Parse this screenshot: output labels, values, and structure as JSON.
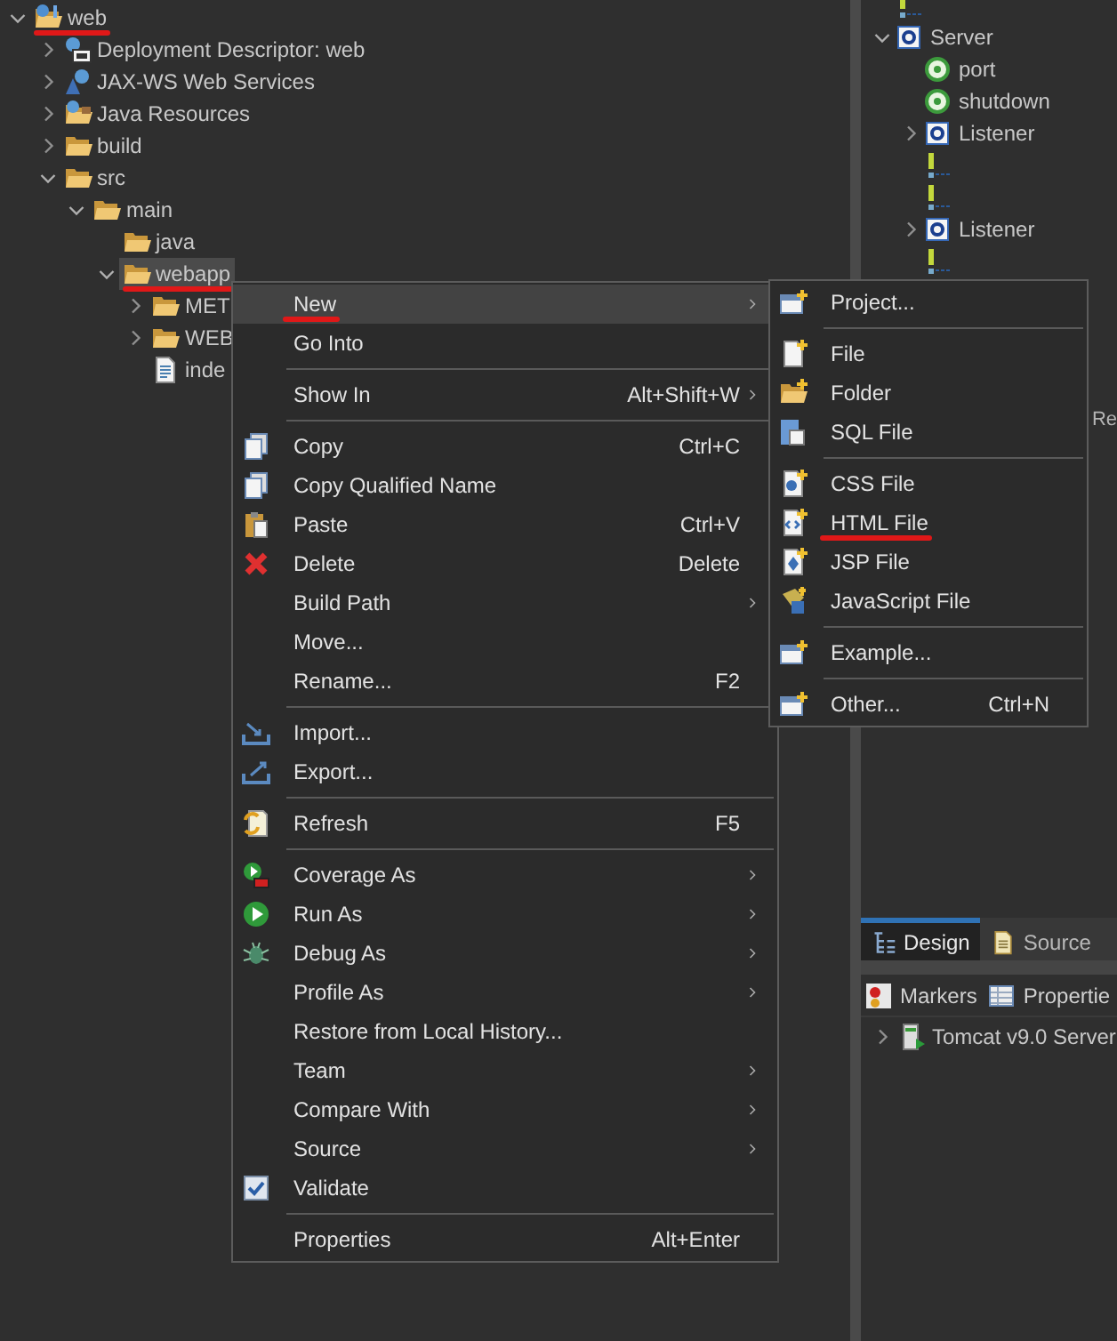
{
  "tree": [
    {
      "label": "web",
      "kind": "project",
      "expanded": true,
      "selected": false,
      "underlined": true,
      "children": [
        {
          "label": "Deployment Descriptor: web",
          "kind": "descriptor",
          "expanded": false,
          "selected": false,
          "underlined": false
        },
        {
          "label": "JAX-WS Web Services",
          "kind": "services",
          "expanded": false,
          "selected": false,
          "underlined": false
        },
        {
          "label": "Java Resources",
          "kind": "resources",
          "expanded": false,
          "selected": false,
          "underlined": false
        },
        {
          "label": "build",
          "kind": "folder",
          "expanded": false,
          "selected": false,
          "underlined": false
        },
        {
          "label": "src",
          "kind": "folder",
          "expanded": true,
          "selected": false,
          "underlined": false,
          "children": [
            {
              "label": "main",
              "kind": "folder",
              "expanded": true,
              "selected": false,
              "underlined": false,
              "children": [
                {
                  "label": "java",
                  "kind": "folder",
                  "selected": false,
                  "underlined": false
                },
                {
                  "label": "webapp",
                  "kind": "folder",
                  "expanded": true,
                  "selected": true,
                  "underlined": true,
                  "children": [
                    {
                      "label": "MET",
                      "kind": "folder",
                      "expanded": false,
                      "selected": false,
                      "underlined": false
                    },
                    {
                      "label": "WEB",
                      "kind": "folder",
                      "expanded": false,
                      "selected": false,
                      "underlined": false
                    },
                    {
                      "label": "inde",
                      "kind": "file",
                      "selected": false,
                      "underlined": false
                    }
                  ]
                }
              ]
            }
          ]
        }
      ]
    }
  ],
  "outline": [
    {
      "kind": "comment"
    },
    {
      "kind": "element",
      "label": "Server",
      "expanded": true,
      "children": [
        {
          "kind": "attribute",
          "label": "port"
        },
        {
          "kind": "attribute",
          "label": "shutdown"
        },
        {
          "kind": "element",
          "label": "Listener",
          "expanded": false
        },
        {
          "kind": "comment"
        },
        {
          "kind": "comment"
        },
        {
          "kind": "element",
          "label": "Listener",
          "expanded": false
        },
        {
          "kind": "comment"
        }
      ]
    }
  ],
  "fragment": "Re",
  "context_menu": [
    {
      "kind": "item",
      "label": "New",
      "submenu": true,
      "selected": true,
      "underlined": true
    },
    {
      "kind": "item",
      "label": "Go Into",
      "selected": false,
      "underlined": false
    },
    {
      "kind": "separator"
    },
    {
      "kind": "item",
      "label": "Show In",
      "shortcut": "Alt+Shift+W",
      "submenu": true,
      "selected": false,
      "underlined": false
    },
    {
      "kind": "separator"
    },
    {
      "kind": "item",
      "label": "Copy",
      "shortcut": "Ctrl+C",
      "selected": false,
      "underlined": false
    },
    {
      "kind": "item",
      "label": "Copy Qualified Name",
      "selected": false,
      "underlined": false
    },
    {
      "kind": "item",
      "label": "Paste",
      "shortcut": "Ctrl+V",
      "selected": false,
      "underlined": false
    },
    {
      "kind": "item",
      "label": "Delete",
      "shortcut": "Delete",
      "selected": false,
      "underlined": false
    },
    {
      "kind": "item",
      "label": "Build Path",
      "submenu": true,
      "selected": false,
      "underlined": false
    },
    {
      "kind": "item",
      "label": "Move...",
      "selected": false,
      "underlined": false
    },
    {
      "kind": "item",
      "label": "Rename...",
      "shortcut": "F2",
      "selected": false,
      "underlined": false
    },
    {
      "kind": "separator"
    },
    {
      "kind": "item",
      "label": "Import...",
      "selected": false,
      "underlined": false
    },
    {
      "kind": "item",
      "label": "Export...",
      "selected": false,
      "underlined": false
    },
    {
      "kind": "separator"
    },
    {
      "kind": "item",
      "label": "Refresh",
      "shortcut": "F5",
      "selected": false,
      "underlined": false
    },
    {
      "kind": "separator"
    },
    {
      "kind": "item",
      "label": "Coverage As",
      "submenu": true,
      "selected": false,
      "underlined": false
    },
    {
      "kind": "item",
      "label": "Run As",
      "submenu": true,
      "selected": false,
      "underlined": false
    },
    {
      "kind": "item",
      "label": "Debug As",
      "submenu": true,
      "selected": false,
      "underlined": false
    },
    {
      "kind": "item",
      "label": "Profile As",
      "submenu": true,
      "selected": false,
      "underlined": false
    },
    {
      "kind": "item",
      "label": "Restore from Local History...",
      "selected": false,
      "underlined": false
    },
    {
      "kind": "item",
      "label": "Team",
      "submenu": true,
      "selected": false,
      "underlined": false
    },
    {
      "kind": "item",
      "label": "Compare With",
      "submenu": true,
      "selected": false,
      "underlined": false
    },
    {
      "kind": "item",
      "label": "Source",
      "submenu": true,
      "selected": false,
      "underlined": false
    },
    {
      "kind": "item",
      "label": "Validate",
      "selected": false,
      "underlined": false
    },
    {
      "kind": "separator"
    },
    {
      "kind": "item",
      "label": "Properties",
      "shortcut": "Alt+Enter",
      "selected": false,
      "underlined": false
    }
  ],
  "new_submenu": [
    {
      "kind": "item",
      "label": "Project...",
      "selected": false,
      "underlined": false
    },
    {
      "kind": "separator"
    },
    {
      "kind": "item",
      "label": "File",
      "selected": false,
      "underlined": false
    },
    {
      "kind": "item",
      "label": "Folder",
      "selected": false,
      "underlined": false
    },
    {
      "kind": "item",
      "label": "SQL File",
      "selected": false,
      "underlined": false
    },
    {
      "kind": "separator"
    },
    {
      "kind": "item",
      "label": "CSS File",
      "selected": false,
      "underlined": false
    },
    {
      "kind": "item",
      "label": "HTML File",
      "selected": false,
      "underlined": true
    },
    {
      "kind": "item",
      "label": "JSP File",
      "selected": false,
      "underlined": false
    },
    {
      "kind": "item",
      "label": "JavaScript File",
      "selected": false,
      "underlined": false
    },
    {
      "kind": "separator"
    },
    {
      "kind": "item",
      "label": "Example...",
      "selected": false,
      "underlined": false
    },
    {
      "kind": "separator"
    },
    {
      "kind": "item",
      "label": "Other...",
      "shortcut": "Ctrl+N",
      "selected": false,
      "underlined": false
    }
  ],
  "editor_tabs": [
    {
      "label": "Design",
      "selected": true
    },
    {
      "label": "Source",
      "selected": false
    }
  ],
  "views": [
    {
      "label": "Markers"
    },
    {
      "label": "Propertie"
    }
  ],
  "servers": [
    {
      "label": "Tomcat v9.0 Server",
      "expanded": false
    }
  ]
}
